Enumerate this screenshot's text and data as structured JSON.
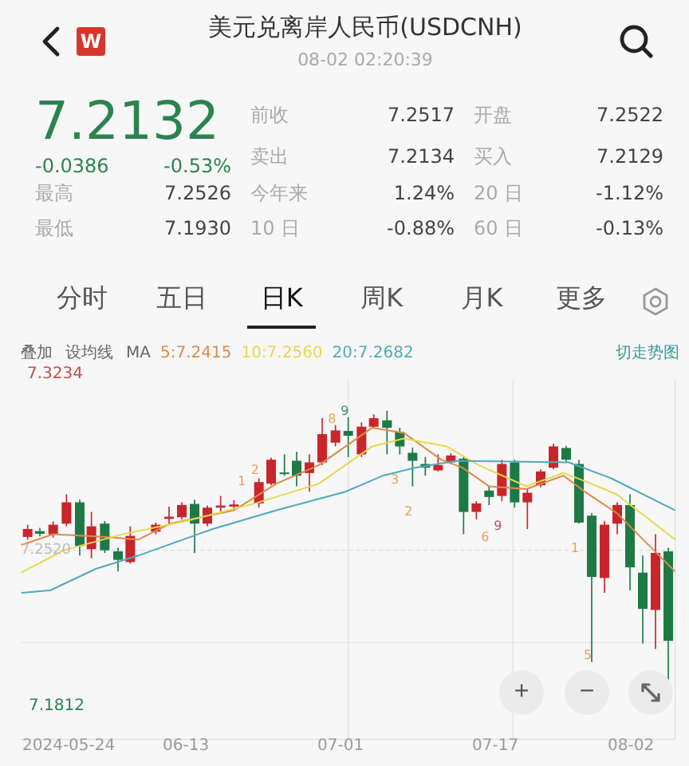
{
  "header": {
    "logo_text": "W",
    "title": "美元兑离岸人民币(USDCNH)",
    "time": "08-02 02:20:39"
  },
  "quote": {
    "price": "7.2132",
    "change": "-0.0386",
    "change_pct": "-0.53%"
  },
  "stats": [
    {
      "label": "前收",
      "value": "7.2517"
    },
    {
      "label": "开盘",
      "value": "7.2522"
    },
    {
      "label": "卖出",
      "value": "7.2134"
    },
    {
      "label": "买入",
      "value": "7.2129"
    },
    {
      "label": "最高",
      "value": "7.2526"
    },
    {
      "label": "今年来",
      "value": "1.24%"
    },
    {
      "label": "20 日",
      "value": "-1.12%"
    },
    {
      "label": "最低",
      "value": "7.1930"
    },
    {
      "label": "10 日",
      "value": "-0.88%"
    },
    {
      "label": "60 日",
      "value": "-0.13%"
    }
  ],
  "tabs": [
    {
      "label": "分时",
      "selected": false
    },
    {
      "label": "五日",
      "selected": false
    },
    {
      "label": "日K",
      "selected": true
    },
    {
      "label": "周K",
      "selected": false
    },
    {
      "label": "月K",
      "selected": false
    },
    {
      "label": "更多",
      "selected": false
    }
  ],
  "indicator_bar": {
    "overlay": "叠加",
    "set_ma": "设均线",
    "ma_label": "MA",
    "switch": "切走势图",
    "ma": [
      {
        "text": "5:7.2415",
        "color": "#e0894a"
      },
      {
        "text": "10:7.2560",
        "color": "#e6d94c"
      },
      {
        "text": "20:7.2682",
        "color": "#4fa9bd"
      }
    ]
  },
  "chart": {
    "high_label": "7.3234",
    "low_label": "7.1812",
    "mid_label": "7.2520",
    "markers": [
      "8",
      "9",
      "1",
      "2",
      "3",
      "2",
      "6",
      "9",
      "1",
      "5"
    ],
    "x_labels": [
      "2024-05-24",
      "06-13",
      "07-01",
      "07-17",
      "08-02"
    ],
    "zoom_in": "+",
    "zoom_out": "−"
  }
}
